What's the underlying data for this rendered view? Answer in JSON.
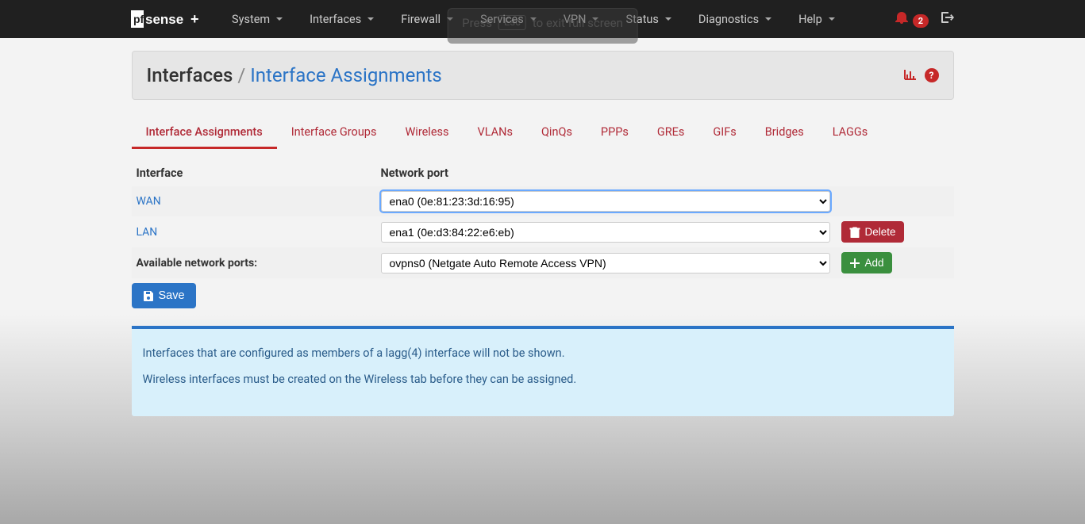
{
  "nav": {
    "items": [
      "System",
      "Interfaces",
      "Firewall",
      "Services",
      "VPN",
      "Status",
      "Diagnostics",
      "Help"
    ],
    "badge": "2"
  },
  "esc_hint": {
    "pre": "Press",
    "key": "Esc",
    "post": "to exit full screen"
  },
  "header": {
    "crumb": "Interfaces",
    "sep": "/",
    "title": "Interface Assignments"
  },
  "tabs": [
    "Interface Assignments",
    "Interface Groups",
    "Wireless",
    "VLANs",
    "QinQs",
    "PPPs",
    "GREs",
    "GIFs",
    "Bridges",
    "LAGGs"
  ],
  "table": {
    "col_interface": "Interface",
    "col_port": "Network port",
    "rows": [
      {
        "iface": "WAN",
        "port": "ena0 (0e:81:23:3d:16:95)"
      },
      {
        "iface": "LAN",
        "port": "ena1 (0e:d3:84:22:e6:eb)"
      }
    ],
    "available_label": "Available network ports:",
    "available_port": "ovpns0 (Netgate Auto Remote Access VPN)",
    "delete_label": "Delete",
    "add_label": "Add",
    "save_label": "Save"
  },
  "info": {
    "line1": "Interfaces that are configured as members of a lagg(4) interface will not be shown.",
    "line2": "Wireless interfaces must be created on the Wireless tab before they can be assigned."
  }
}
